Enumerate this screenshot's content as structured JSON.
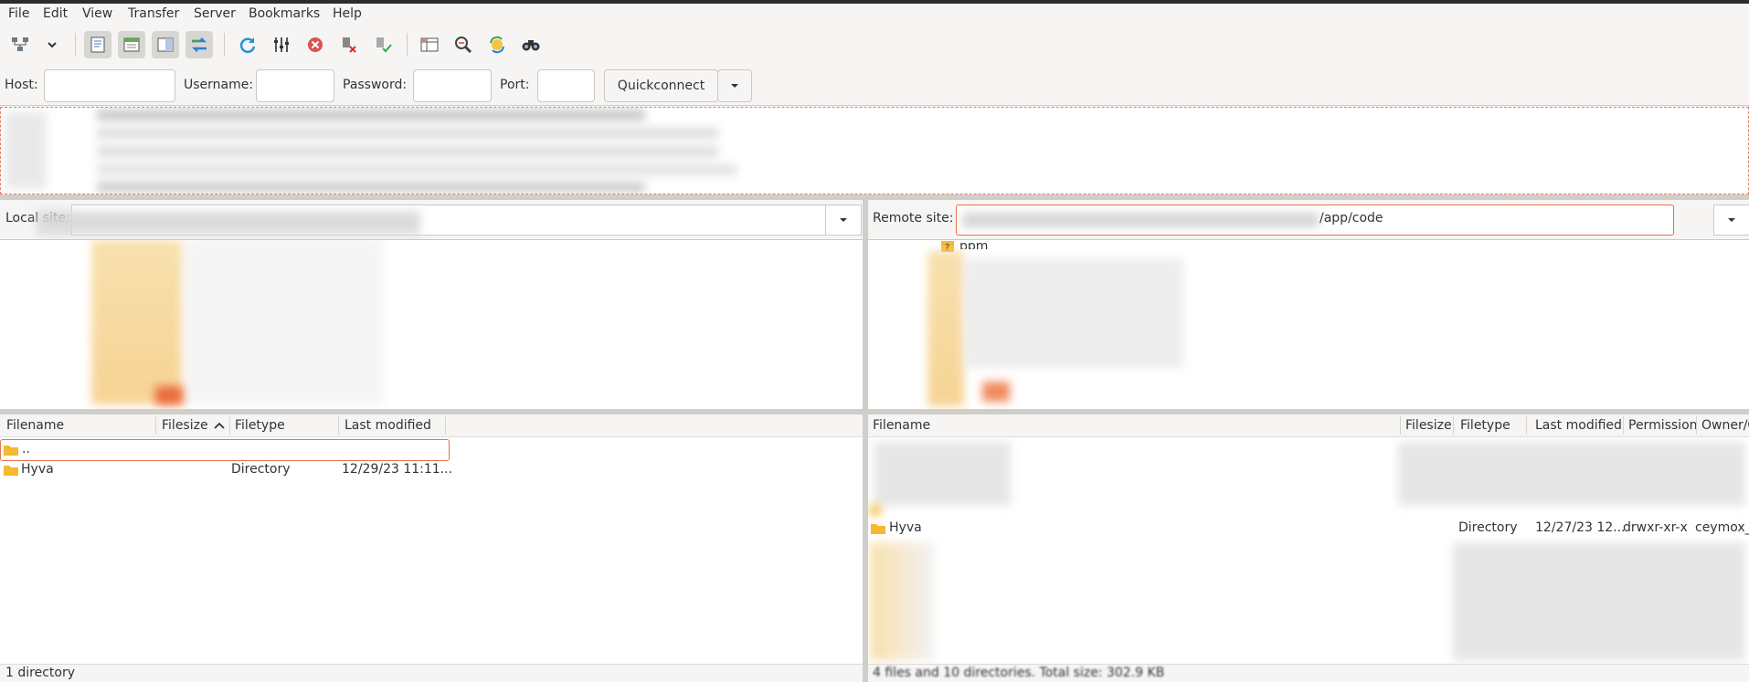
{
  "menu": [
    "File",
    "Edit",
    "View",
    "Transfer",
    "Server",
    "Bookmarks",
    "Help"
  ],
  "toolbar": {
    "icons": [
      "site-manager-icon",
      "dropdown-arrow-icon",
      "toggle-message-log-icon",
      "toggle-local-tree-icon",
      "toggle-remote-tree-icon",
      "transfer-queue-icon",
      "refresh-icon",
      "process-queue-icon",
      "cancel-icon",
      "disconnect-icon",
      "reconnect-icon",
      "directory-filter-icon",
      "compare-icon",
      "sync-browse-icon",
      "search-icon"
    ]
  },
  "quickconnect": {
    "host_label": "Host:",
    "username_label": "Username:",
    "password_label": "Password:",
    "port_label": "Port:",
    "button_label": "Quickconnect",
    "host_value": "",
    "username_value": "",
    "password_value": "",
    "port_value": ""
  },
  "local": {
    "site_label": "Local site:",
    "columns": [
      "Filename",
      "Filesize",
      "Filetype",
      "Last modified"
    ],
    "rows": [
      {
        "name": "..",
        "size": "",
        "type": "",
        "modified": ""
      },
      {
        "name": "Hyva",
        "size": "",
        "type": "Directory",
        "modified": "12/29/23 11:11..."
      }
    ],
    "status": "1 directory"
  },
  "remote": {
    "site_label": "Remote site:",
    "path_visible": "/app/code",
    "tree_top_item": "ppm",
    "columns": [
      "Filename",
      "Filesize",
      "Filetype",
      "Last modified",
      "Permission",
      "Owner/G"
    ],
    "visible_row": {
      "name": "Hyva",
      "size": "",
      "type": "Directory",
      "modified": "12/27/23 12...",
      "permission": "drwxr-xr-x",
      "owner": "ceymox_"
    },
    "status": "4 files and 10 directories. Total size: 302.9 KB"
  },
  "colors": {
    "accent": "#e9714a",
    "folder": "#f5b82e",
    "window_bg": "#f6f5f4"
  }
}
